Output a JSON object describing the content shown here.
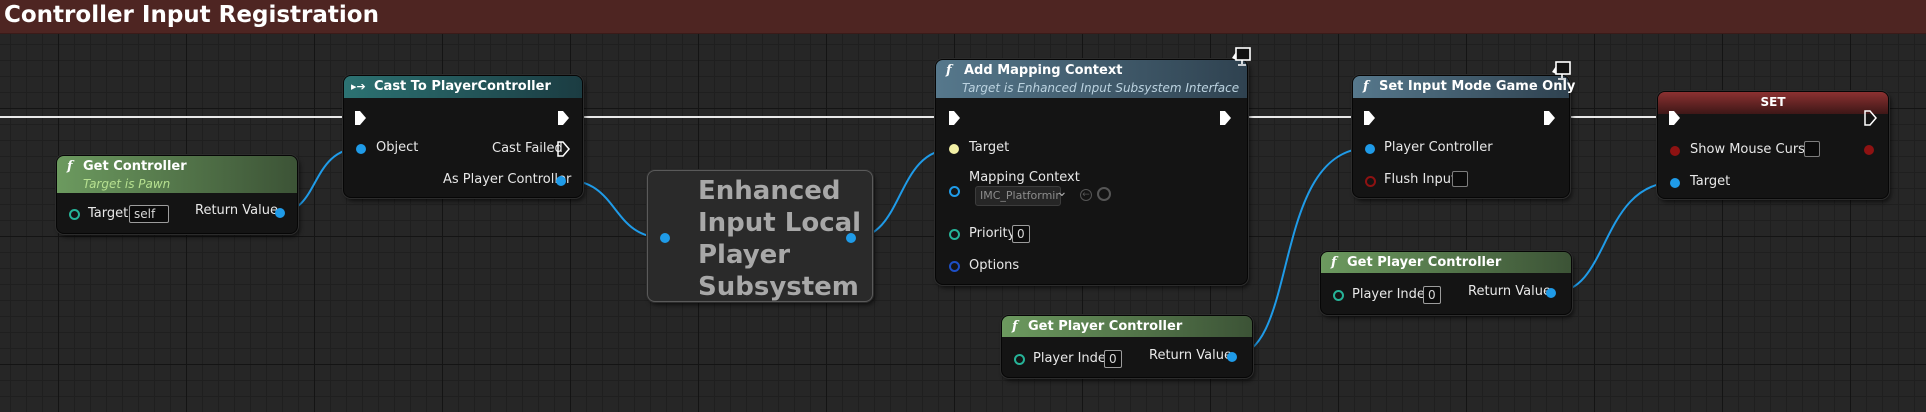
{
  "graph": {
    "title": "Controller Input Registration"
  },
  "nodes": {
    "get_controller": {
      "title": "Get Controller",
      "subtitle": "Target is Pawn",
      "target_label": "Target",
      "target_value": "self",
      "return_label": "Return Value"
    },
    "cast": {
      "title": "Cast To PlayerController",
      "object_label": "Object",
      "cast_failed_label": "Cast Failed",
      "as_pc_label": "As Player Controller"
    },
    "subsystem": {
      "line1": "Enhanced",
      "line2": "Input Local",
      "line3": "Player",
      "line4": "Subsystem"
    },
    "add_mapping": {
      "title": "Add Mapping Context",
      "subtitle": "Target is Enhanced Input Subsystem Interface",
      "target_label": "Target",
      "mapping_label": "Mapping Context",
      "mapping_value": "IMC_Platformir",
      "priority_label": "Priority",
      "priority_value": "0",
      "options_label": "Options"
    },
    "set_input_mode": {
      "title": "Set Input Mode Game Only",
      "pc_label": "Player Controller",
      "flush_label": "Flush Input"
    },
    "set": {
      "title": "SET",
      "show_cursor_label": "Show Mouse Cursor",
      "target_label": "Target"
    },
    "get_pc_1": {
      "title": "Get Player Controller",
      "index_label": "Player Index",
      "index_value": "0",
      "return_label": "Return Value"
    },
    "get_pc_2": {
      "title": "Get Player Controller",
      "index_label": "Player Index",
      "index_value": "0",
      "return_label": "Return Value"
    }
  },
  "colors": {
    "exec": "#ffffff",
    "object_pin": "#1f9be8",
    "title_bar": "#4e2522"
  },
  "icons": [
    "function-icon",
    "cast-icon",
    "exec-pin-icon",
    "dropdown-arrow-icon",
    "browse-icon",
    "search-icon",
    "monitor-icon"
  ]
}
